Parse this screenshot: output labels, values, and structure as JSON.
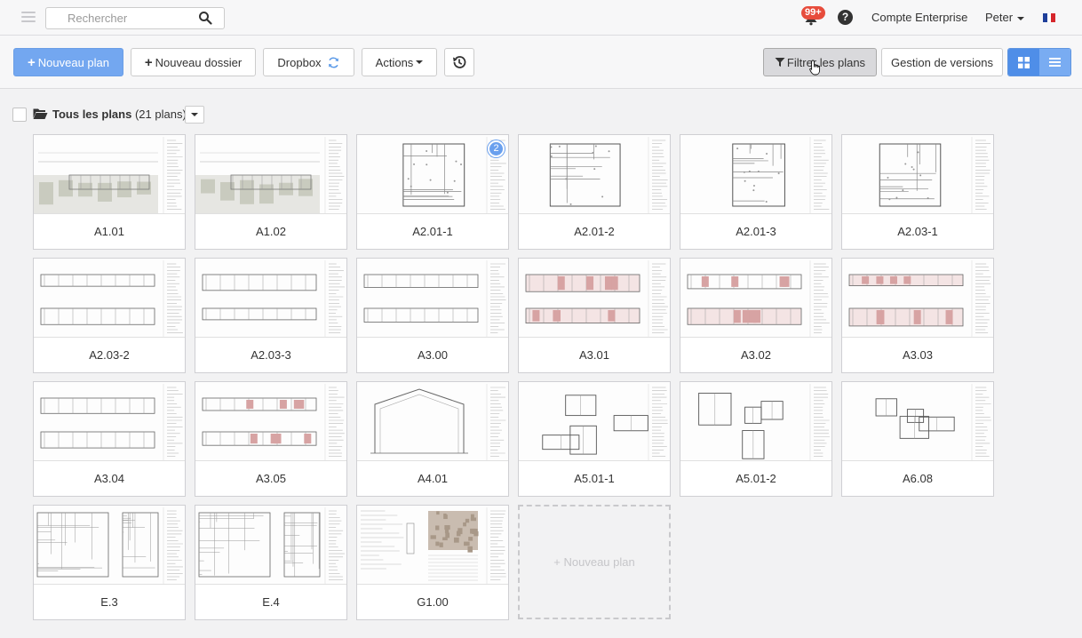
{
  "topbar": {
    "search_placeholder": "Rechercher",
    "notifications_badge": "99+",
    "help_glyph": "?",
    "account_label": "Compte Enterprise",
    "user_label": "Peter",
    "flag_colors": [
      "#1f3f9a",
      "#ffffff",
      "#d6262c"
    ]
  },
  "toolbar": {
    "new_plan": "Nouveau plan",
    "new_folder": "Nouveau dossier",
    "dropbox": "Dropbox",
    "actions": "Actions",
    "filter": "Filtrer les plans",
    "versions": "Gestion de versions"
  },
  "folder": {
    "name": "Tous les plans",
    "count": "(21 plans)"
  },
  "plans": [
    {
      "label": "A1.01",
      "kind": "site"
    },
    {
      "label": "A1.02",
      "kind": "site"
    },
    {
      "label": "A2.01-1",
      "kind": "floor",
      "badge": "2"
    },
    {
      "label": "A2.01-2",
      "kind": "floor"
    },
    {
      "label": "A2.01-3",
      "kind": "floor"
    },
    {
      "label": "A2.03-1",
      "kind": "floor"
    },
    {
      "label": "A2.03-2",
      "kind": "elev"
    },
    {
      "label": "A2.03-3",
      "kind": "elev"
    },
    {
      "label": "A3.00",
      "kind": "elev"
    },
    {
      "label": "A3.01",
      "kind": "elevred"
    },
    {
      "label": "A3.02",
      "kind": "elevred"
    },
    {
      "label": "A3.03",
      "kind": "elevred"
    },
    {
      "label": "A3.04",
      "kind": "elev"
    },
    {
      "label": "A3.05",
      "kind": "elevred"
    },
    {
      "label": "A4.01",
      "kind": "section"
    },
    {
      "label": "A5.01-1",
      "kind": "detail"
    },
    {
      "label": "A5.01-2",
      "kind": "detail"
    },
    {
      "label": "A6.08",
      "kind": "detail"
    },
    {
      "label": "E.3",
      "kind": "electric"
    },
    {
      "label": "E.4",
      "kind": "electric"
    },
    {
      "label": "G1.00",
      "kind": "cover"
    }
  ],
  "new_plan_card": "+ Nouveau plan"
}
